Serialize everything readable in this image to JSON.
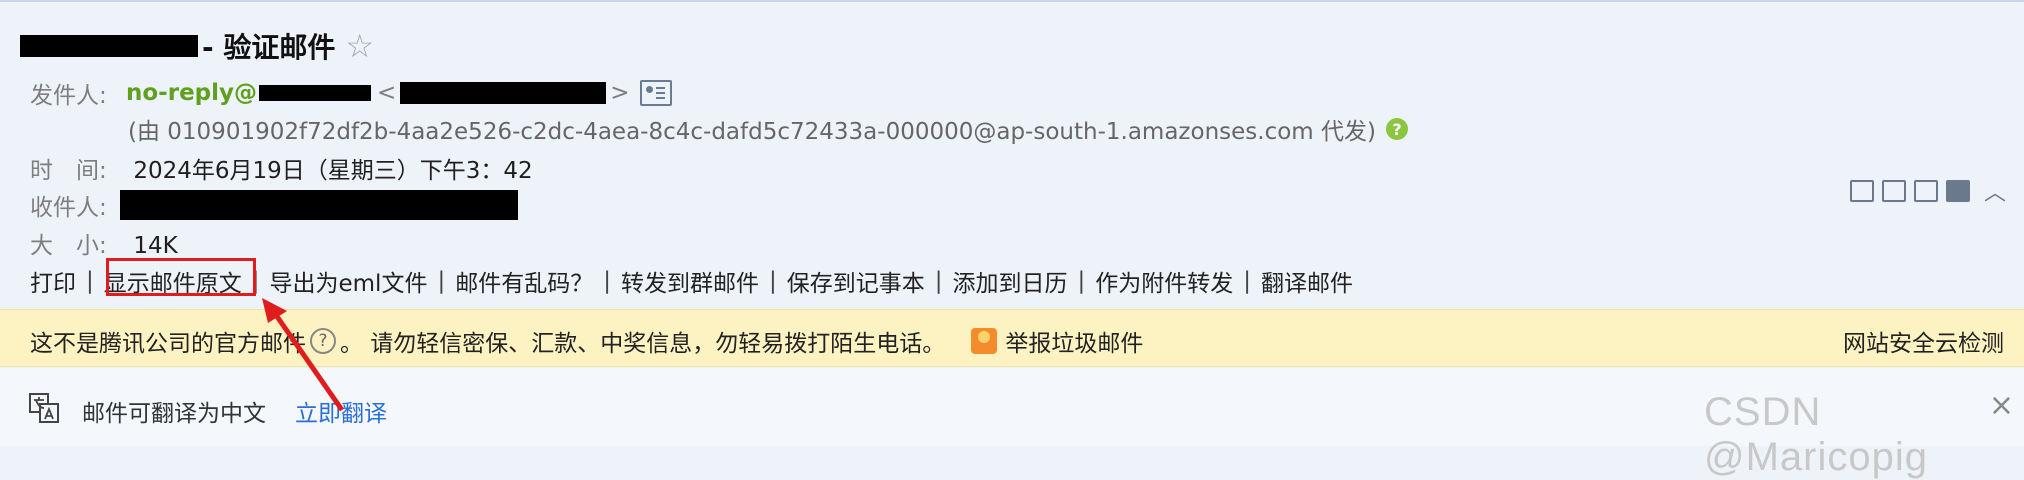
{
  "subject": {
    "text": "- 验证邮件",
    "star_icon": "star-icon"
  },
  "meta": {
    "sender_label": "发件人:",
    "sender_name": "no-reply@",
    "sender_open": "<",
    "sender_close": ">",
    "via_text": "(由 010901902f72df2b-4aa2e526-c2dc-4aea-8c4c-dafd5c72433a-000000@ap-south-1.amazonses.com 代发)",
    "help_glyph": "?",
    "time_label": "时　间:",
    "time_value": "2024年6月19日（星期三）下午3：42",
    "to_label": "收件人:",
    "size_label": "大　小:",
    "size_value": "14K"
  },
  "actions": {
    "print": "打印",
    "show_source": "显示邮件原文",
    "export_eml": "导出为eml文件",
    "garbled": "邮件有乱码？",
    "forward_group": "转发到群邮件",
    "save_note": "保存到记事本",
    "add_calendar": "添加到日历",
    "forward_attachment": "作为附件转发",
    "translate_mail": "翻译邮件",
    "separator": "|"
  },
  "warning": {
    "not_official": "这不是腾讯公司的官方邮件",
    "q_glyph": "?",
    "advice": "。 请勿轻信密保、汇款、中奖信息，勿轻易拨打陌生电话。",
    "report_spam": "举报垃圾邮件",
    "security_check": "网站安全云检测"
  },
  "translate_bar": {
    "text": "邮件可翻译为中文",
    "link": "立即翻译",
    "close": "×"
  },
  "watermark": "CSDN @Maricopig",
  "colors": {
    "sender_green": "#5fa01e",
    "warning_bg": "#fdf3c2",
    "link_blue": "#2a6fd6",
    "annotation_red": "#e01c1c"
  }
}
